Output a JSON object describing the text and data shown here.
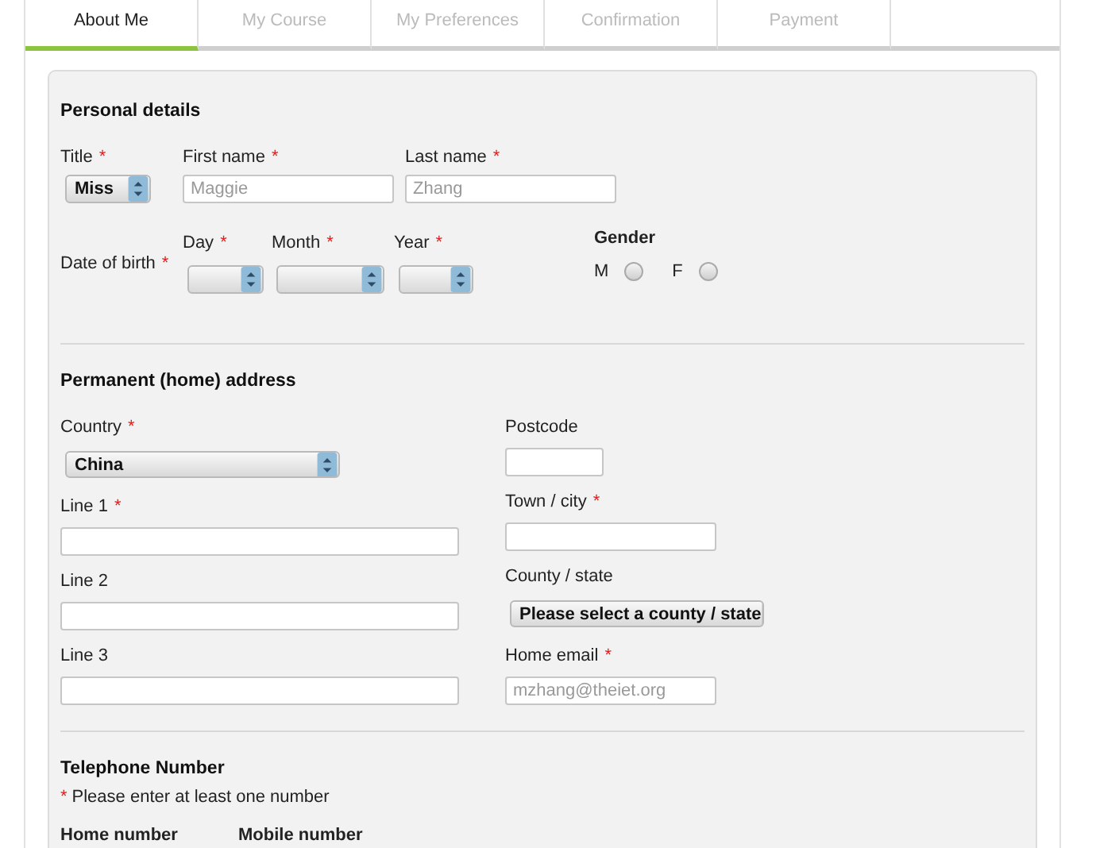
{
  "required_mark": "*",
  "tabs": [
    {
      "label": "About Me",
      "selected": true
    },
    {
      "label": "My Course",
      "selected": false
    },
    {
      "label": "My Preferences",
      "selected": false
    },
    {
      "label": "Confirmation",
      "selected": false
    },
    {
      "label": "Payment",
      "selected": false
    }
  ],
  "personal": {
    "heading": "Personal details",
    "title": {
      "label": "Title",
      "required": true,
      "value": "Miss"
    },
    "first_name": {
      "label": "First name",
      "required": true,
      "placeholder": "Maggie"
    },
    "last_name": {
      "label": "Last name",
      "required": true,
      "placeholder": "Zhang"
    },
    "date_of_birth": {
      "label": "Date of birth",
      "required": true,
      "parts": [
        {
          "label": "Day",
          "required": true
        },
        {
          "label": "Month",
          "required": true
        },
        {
          "label": "Year",
          "required": true
        }
      ]
    },
    "gender": {
      "label": "Gender",
      "options": [
        {
          "label": "M",
          "selected": false
        },
        {
          "label": "F",
          "selected": false
        }
      ]
    }
  },
  "address": {
    "heading": "Permanent (home) address",
    "country": {
      "label": "Country",
      "required": true,
      "value": "China"
    },
    "lines": [
      {
        "label": "Line 1",
        "required": true
      },
      {
        "label": "Line 2",
        "required": false
      },
      {
        "label": "Line 3",
        "required": false
      }
    ],
    "postcode": {
      "label": "Postcode",
      "required": false
    },
    "town": {
      "label": "Town / city",
      "required": true
    },
    "county": {
      "label": "County / state",
      "required": false,
      "value": "Please select a county / state"
    },
    "email": {
      "label": "Home email",
      "required": true,
      "placeholder": "mzhang@theiet.org"
    }
  },
  "telephone": {
    "heading": "Telephone Number",
    "note": "Please enter at least one number",
    "columns": [
      "Home number",
      "Mobile number"
    ]
  }
}
